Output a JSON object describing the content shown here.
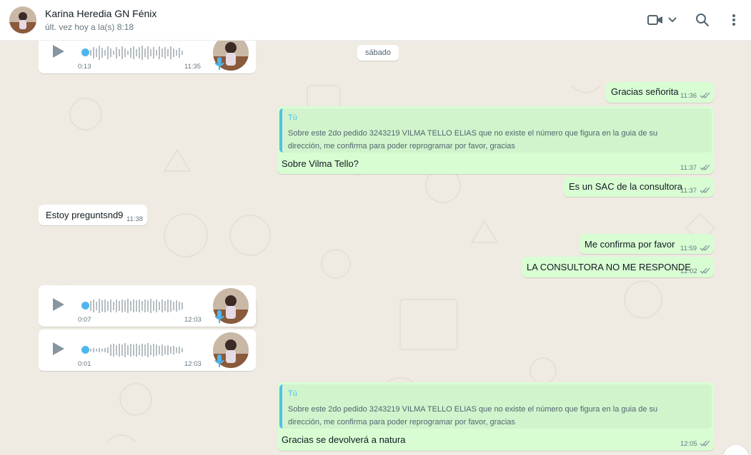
{
  "header": {
    "contact_name": "Karina Heredia GN Fénix",
    "contact_status": "últ. vez hoy a la(s) 8:18",
    "icons": [
      "video-call-icon",
      "chevron-down-icon",
      "search-icon",
      "menu-dots-icon"
    ]
  },
  "colors": {
    "outgoing": "#d9fdd3",
    "incoming": "#ffffff",
    "chat_bg": "#efeae2",
    "read_ticks": "#8696a0",
    "audio_dot": "#4fb6ec",
    "quote_accent": "#53bdeb"
  },
  "date_chip": "sábado",
  "voice_notes": [
    {
      "duration": "0:13",
      "time": "11:35"
    },
    {
      "duration": "0:07",
      "time": "12:03"
    },
    {
      "duration": "0:01",
      "time": "12:03"
    }
  ],
  "messages": [
    {
      "text": "Gracias señorita",
      "time": "11:36"
    },
    {
      "quote_author": "Tú",
      "quote_text": "Sobre este 2do pedido 3243219 VILMA TELLO ELIAS que no existe el número que figura en la guia de su dirección, me confirma para poder reprogramar por favor, gracias",
      "text": "Sobre Vilma Tello?",
      "time": "11:37"
    },
    {
      "text": "Es un SAC de la consultora",
      "time": "11:37"
    },
    {
      "text": "Estoy preguntsnd9",
      "time": "11:38"
    },
    {
      "text": "Me confirma por favor",
      "time": "11:59"
    },
    {
      "text": "LA CONSULTORA NO ME RESPONDE",
      "time": "12:02"
    },
    {
      "quote_author": "Tú",
      "quote_text": "Sobre este 2do pedido 3243219 VILMA TELLO ELIAS que no existe el número que figura en la guia de su dirección, me confirma para poder reprogramar por favor, gracias",
      "text": "Gracias se devolverá a natura",
      "time": "12:05"
    }
  ]
}
